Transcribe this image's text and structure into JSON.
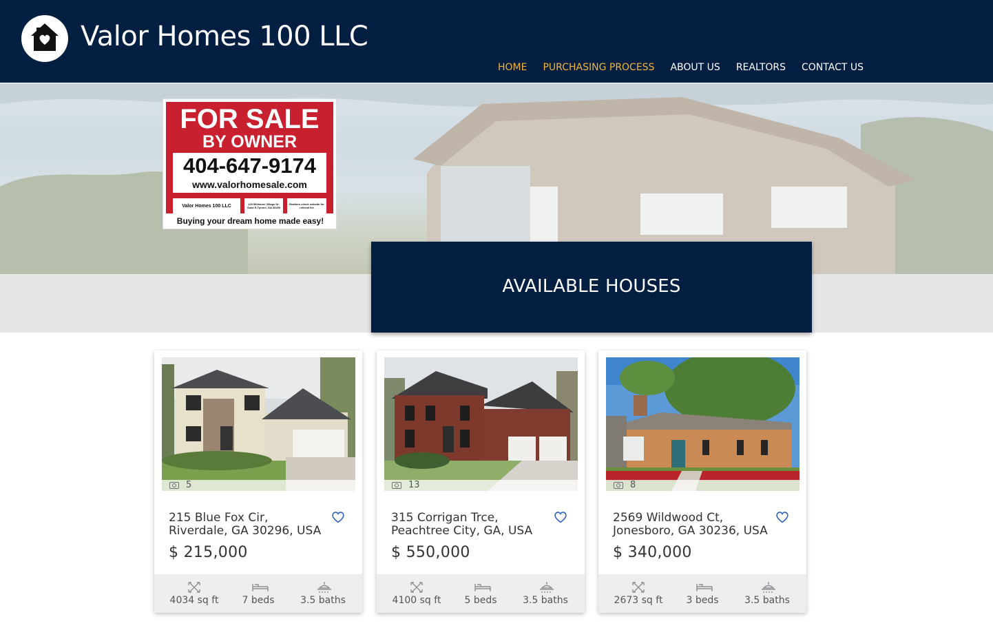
{
  "header": {
    "site_title": "Valor Homes 100 LLC",
    "logo_icon": "house-heart-icon",
    "nav": [
      {
        "label": "HOME",
        "active": true
      },
      {
        "label": "PURCHASING PROCESS",
        "active": true
      },
      {
        "label": "ABOUT US",
        "active": false
      },
      {
        "label": "REALTORS",
        "active": false
      },
      {
        "label": "CONTACT US",
        "active": false
      }
    ],
    "colors": {
      "header_bg": "#021e40",
      "nav_active": "#f2b63c"
    }
  },
  "hero": {
    "sign": {
      "line1": "FOR SALE",
      "line2": "BY OWNER",
      "phone": "404-647-9174",
      "website": "www.valorhomesale.com",
      "company": "Valor Homes 100 LLC",
      "address_small": "120 Millstone Village Dr. Suite E,Tyrone, GA 30290",
      "realtor_note": "Realtors check website for referral fee",
      "tagline": "Buying your dream home made easy!"
    },
    "section_title": "AVAILABLE HOUSES"
  },
  "listings": [
    {
      "photo_count": "5",
      "address": "215 Blue Fox Cir, Riverdale, GA 30296, USA",
      "price": "$ 215,000",
      "sqft": "4034 sq ft",
      "beds": "7 beds",
      "baths": "3.5 baths"
    },
    {
      "photo_count": "13",
      "address": "315 Corrigan Trce, Peachtree City, GA, USA",
      "price": "$ 550,000",
      "sqft": "4100 sq ft",
      "beds": "5 beds",
      "baths": "3.5 baths"
    },
    {
      "photo_count": "8",
      "address": "2569 Wildwood Ct, Jonesboro, GA 30236, USA",
      "price": "$ 340,000",
      "sqft": "2673 sq ft",
      "beds": "3 beds",
      "baths": "3.5 baths"
    }
  ]
}
